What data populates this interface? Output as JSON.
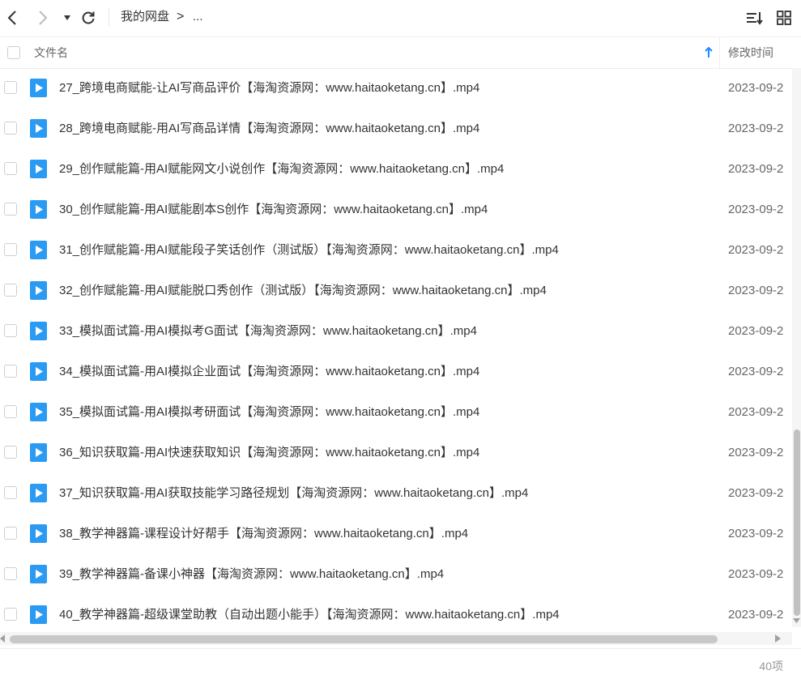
{
  "toolbar": {
    "breadcrumb_root": "我的网盘",
    "breadcrumb_sep": ">",
    "breadcrumb_more": "..."
  },
  "header": {
    "name_col": "文件名",
    "date_col": "修改时间"
  },
  "files": [
    {
      "name": "27_跨境电商赋能-让AI写商品评价【海淘资源网：www.haitaoketang.cn】.mp4",
      "date": "2023-09-2"
    },
    {
      "name": "28_跨境电商赋能-用AI写商品详情【海淘资源网：www.haitaoketang.cn】.mp4",
      "date": "2023-09-2"
    },
    {
      "name": "29_创作赋能篇-用AI赋能网文小说创作【海淘资源网：www.haitaoketang.cn】.mp4",
      "date": "2023-09-2"
    },
    {
      "name": "30_创作赋能篇-用AI赋能剧本S创作【海淘资源网：www.haitaoketang.cn】.mp4",
      "date": "2023-09-2"
    },
    {
      "name": "31_创作赋能篇-用AI赋能段子笑话创作（测试版）【海淘资源网：www.haitaoketang.cn】.mp4",
      "date": "2023-09-2"
    },
    {
      "name": "32_创作赋能篇-用AI赋能脱口秀创作（测试版）【海淘资源网：www.haitaoketang.cn】.mp4",
      "date": "2023-09-2"
    },
    {
      "name": "33_模拟面试篇-用AI模拟考G面试【海淘资源网：www.haitaoketang.cn】.mp4",
      "date": "2023-09-2"
    },
    {
      "name": "34_模拟面试篇-用AI模拟企业面试【海淘资源网：www.haitaoketang.cn】.mp4",
      "date": "2023-09-2"
    },
    {
      "name": "35_模拟面试篇-用AI模拟考研面试【海淘资源网：www.haitaoketang.cn】.mp4",
      "date": "2023-09-2"
    },
    {
      "name": "36_知识获取篇-用AI快速获取知识【海淘资源网：www.haitaoketang.cn】.mp4",
      "date": "2023-09-2"
    },
    {
      "name": "37_知识获取篇-用AI获取技能学习路径规划【海淘资源网：www.haitaoketang.cn】.mp4",
      "date": "2023-09-2"
    },
    {
      "name": "38_教学神器篇-课程设计好帮手【海淘资源网：www.haitaoketang.cn】.mp4",
      "date": "2023-09-2"
    },
    {
      "name": "39_教学神器篇-备课小神器【海淘资源网：www.haitaoketang.cn】.mp4",
      "date": "2023-09-2"
    },
    {
      "name": "40_教学神器篇-超级课堂助教（自动出题小能手）【海淘资源网：www.haitaoketang.cn】.mp4",
      "date": "2023-09-2"
    }
  ],
  "footer": {
    "count": "40项"
  },
  "colors": {
    "accent": "#1a8cff",
    "file_icon": "#2b9af3"
  }
}
